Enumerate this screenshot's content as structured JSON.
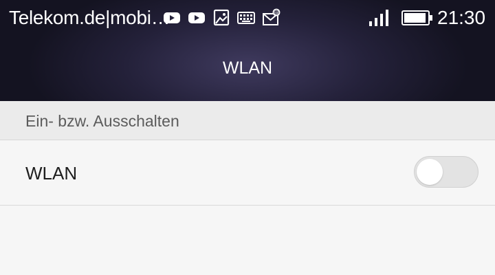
{
  "status_bar": {
    "carrier": "Telekom.de|mobi…",
    "notification_icons": [
      "youtube-icon",
      "youtube-icon",
      "image-icon",
      "keyboard-icon",
      "mail-icon"
    ],
    "signal": "signal-strength-icon",
    "battery": "battery-icon",
    "time": "21:30"
  },
  "title_bar": {
    "title": "WLAN"
  },
  "section": {
    "label": "Ein- bzw. Ausschalten"
  },
  "wlan_row": {
    "label": "WLAN",
    "toggle_on": false
  },
  "colors": {
    "header": "#24213a",
    "background": "#f6f6f6",
    "section_background": "#ebebeb",
    "toggle_off": "#e3e3e3"
  }
}
